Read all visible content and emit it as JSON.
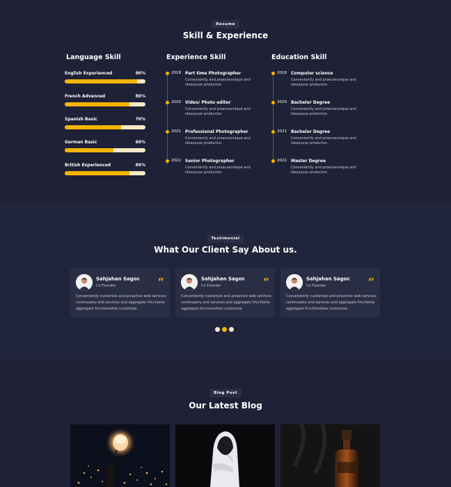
{
  "resume": {
    "tag": "Resume",
    "heading": "Skill & Experience",
    "language": {
      "title": "Language Skill",
      "items": [
        {
          "label": "English Experienced",
          "percent_text": "90%",
          "level": 90
        },
        {
          "label": "French Advanced",
          "percent_text": "80%",
          "level": 80
        },
        {
          "label": "Spanish Basic",
          "percent_text": "70%",
          "level": 70
        },
        {
          "label": "German Basic",
          "percent_text": "60%",
          "level": 60
        },
        {
          "label": "British Experienced",
          "percent_text": "80%",
          "level": 80
        }
      ]
    },
    "experience": {
      "title": "Experience Skill",
      "items": [
        {
          "year": "2018",
          "title": "Part time Photographer",
          "desc": "Conveniently and proacveunique and ideasyuse producton."
        },
        {
          "year": "2020",
          "title": "Video/ Photo editor",
          "desc": "Conveniently and proacveunique and ideasyuse producton."
        },
        {
          "year": "2021",
          "title": "Professional Photographer",
          "desc": "Conveniently and proacveunique and ideasyuse producton."
        },
        {
          "year": "2022",
          "title": "Senior Photographer",
          "desc": "Conveniently and proacveunique and ideasyuse producton."
        }
      ]
    },
    "education": {
      "title": "Education Skill",
      "items": [
        {
          "year": "2018",
          "title": "Computer science",
          "desc": "Conveniently and proacveunique and ideasyuse producton."
        },
        {
          "year": "2020",
          "title": "Bachelor Degree",
          "desc": "Conveniently and proacveunique and ideasyuse producton."
        },
        {
          "year": "2021",
          "title": "Bachelor Degree",
          "desc": "Conveniently and proacveunique and ideasyuse producton."
        },
        {
          "year": "2022",
          "title": "Master Degree",
          "desc": "Conveniently and proacveunique and ideasyuse producton."
        }
      ]
    }
  },
  "testimonial": {
    "tag": "Testimonial",
    "heading": "What Our Client Say About us.",
    "cards": [
      {
        "name": "Sahjahan Sagor.",
        "role": "Co Founder",
        "text": "Conveniently customize and proactive web services continuaery and services and aggregate fricctionle aggregate fricctionellies customize."
      },
      {
        "name": "Sahjahan Sagor.",
        "role": "Co Founder",
        "text": "Conveniently customize and proactive web services continuaery and services and aggregate fricctionle aggregate fricctionellies customize."
      },
      {
        "name": "Sahjahan Sagor.",
        "role": "Co Founder",
        "text": "Conveniently customize and proactive web services continuaery and services and aggregate fricctionle aggregate fricctionellies customize."
      }
    ],
    "quote_icon": "quote-icon",
    "pagination": {
      "count": 3,
      "active_index": 1
    }
  },
  "blog": {
    "tag": "Blog Post",
    "heading": "Our Latest Blog",
    "images": [
      "sky-lantern-photo",
      "hooded-figure-photo",
      "whiskey-bottle-photo"
    ]
  },
  "colors": {
    "accent": "#f5b400",
    "background": "#1f2236",
    "card": "#2a2e45",
    "bar_track": "#f7e8c6"
  }
}
